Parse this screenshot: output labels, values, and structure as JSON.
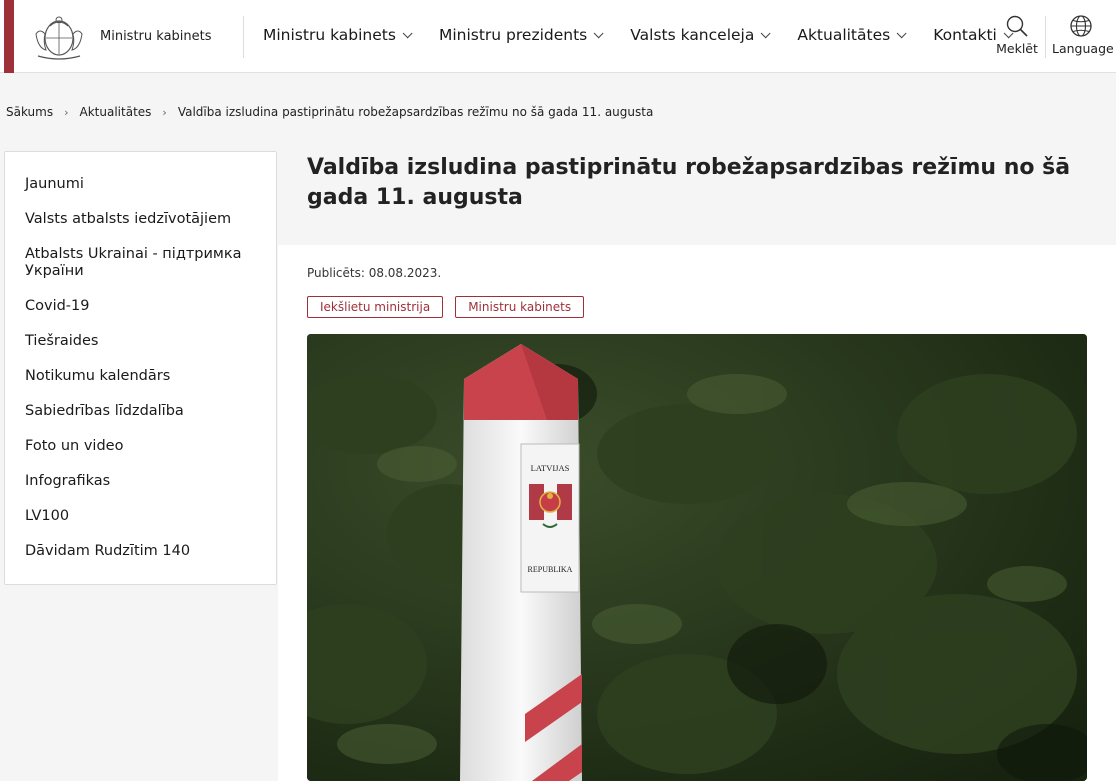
{
  "header": {
    "brand": "Ministru kabinets",
    "nav": [
      {
        "label": "Ministru kabinets"
      },
      {
        "label": "Ministru prezidents"
      },
      {
        "label": "Valsts kanceleja"
      },
      {
        "label": "Aktualitātes"
      },
      {
        "label": "Kontakti"
      }
    ],
    "search_label": "Meklēt",
    "language_label": "Language"
  },
  "breadcrumb": [
    "Sākums",
    "Aktualitātes",
    "Valdība izsludina pastiprinātu robežapsardzības režīmu no šā gada 11. augusta"
  ],
  "sidebar": {
    "items": [
      {
        "label": "Jaunumi"
      },
      {
        "label": "Valsts atbalsts iedzīvotājiem"
      },
      {
        "label": "Atbalsts Ukrainai - підтримка України"
      },
      {
        "label": "Covid-19"
      },
      {
        "label": "Tiešraides"
      },
      {
        "label": "Notikumu kalendārs"
      },
      {
        "label": "Sabiedrības līdzdalība"
      },
      {
        "label": "Foto un video"
      },
      {
        "label": "Infografikas"
      },
      {
        "label": "LV100"
      },
      {
        "label": "Dāvidam Rudzītim 140"
      }
    ]
  },
  "article": {
    "title": "Valdība izsludina pastiprinātu robežapsardzības režīmu no šā gada 11. augusta",
    "published": "Publicēts: 08.08.2023.",
    "tags": [
      "Iekšlietu ministrija",
      "Ministru kabinets"
    ],
    "plaque_top": "LATVIJAS",
    "plaque_bottom": "REPUBLIKA"
  },
  "colors": {
    "brand": "#9e3039",
    "background": "#f5f5f5"
  }
}
